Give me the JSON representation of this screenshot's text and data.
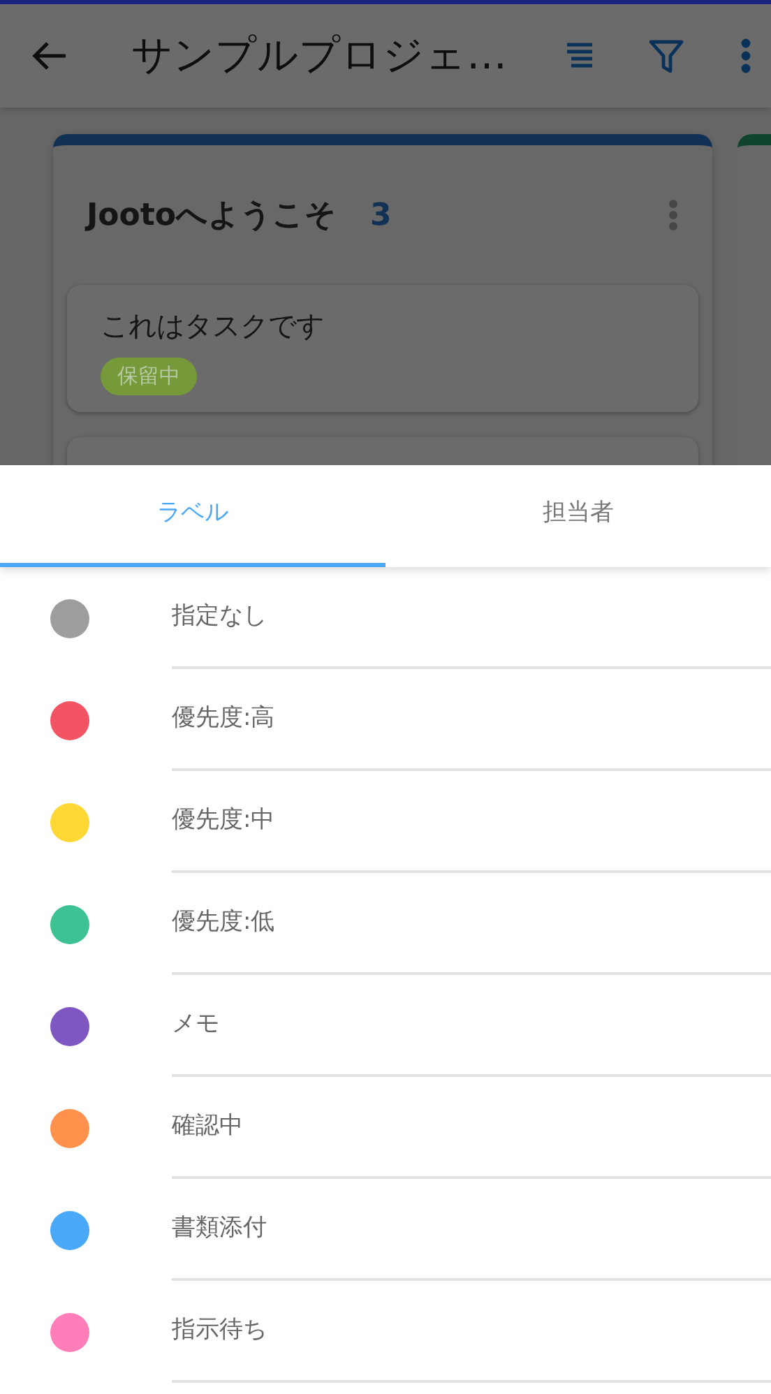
{
  "header": {
    "title": "サンプルプロジェ…"
  },
  "column": {
    "title": "Jootoへようこそ",
    "count": "3",
    "tasks": [
      {
        "title": "これはタスクです",
        "tag": {
          "text": "保留中",
          "color": "#76993a"
        }
      }
    ]
  },
  "sheet": {
    "tabs": [
      {
        "label": "ラベル",
        "selected": true
      },
      {
        "label": "担当者",
        "selected": false
      }
    ],
    "labels": [
      {
        "name": "指定なし",
        "color": "#9e9e9e"
      },
      {
        "name": "優先度:高",
        "color": "#f25464"
      },
      {
        "name": "優先度:中",
        "color": "#fdd835"
      },
      {
        "name": "優先度:低",
        "color": "#3dc393"
      },
      {
        "name": "メモ",
        "color": "#7e57c2"
      },
      {
        "name": "確認中",
        "color": "#ff914d"
      },
      {
        "name": "書類添付",
        "color": "#4aa8f8"
      },
      {
        "name": "指示待ち",
        "color": "#ff7eb9"
      }
    ]
  }
}
